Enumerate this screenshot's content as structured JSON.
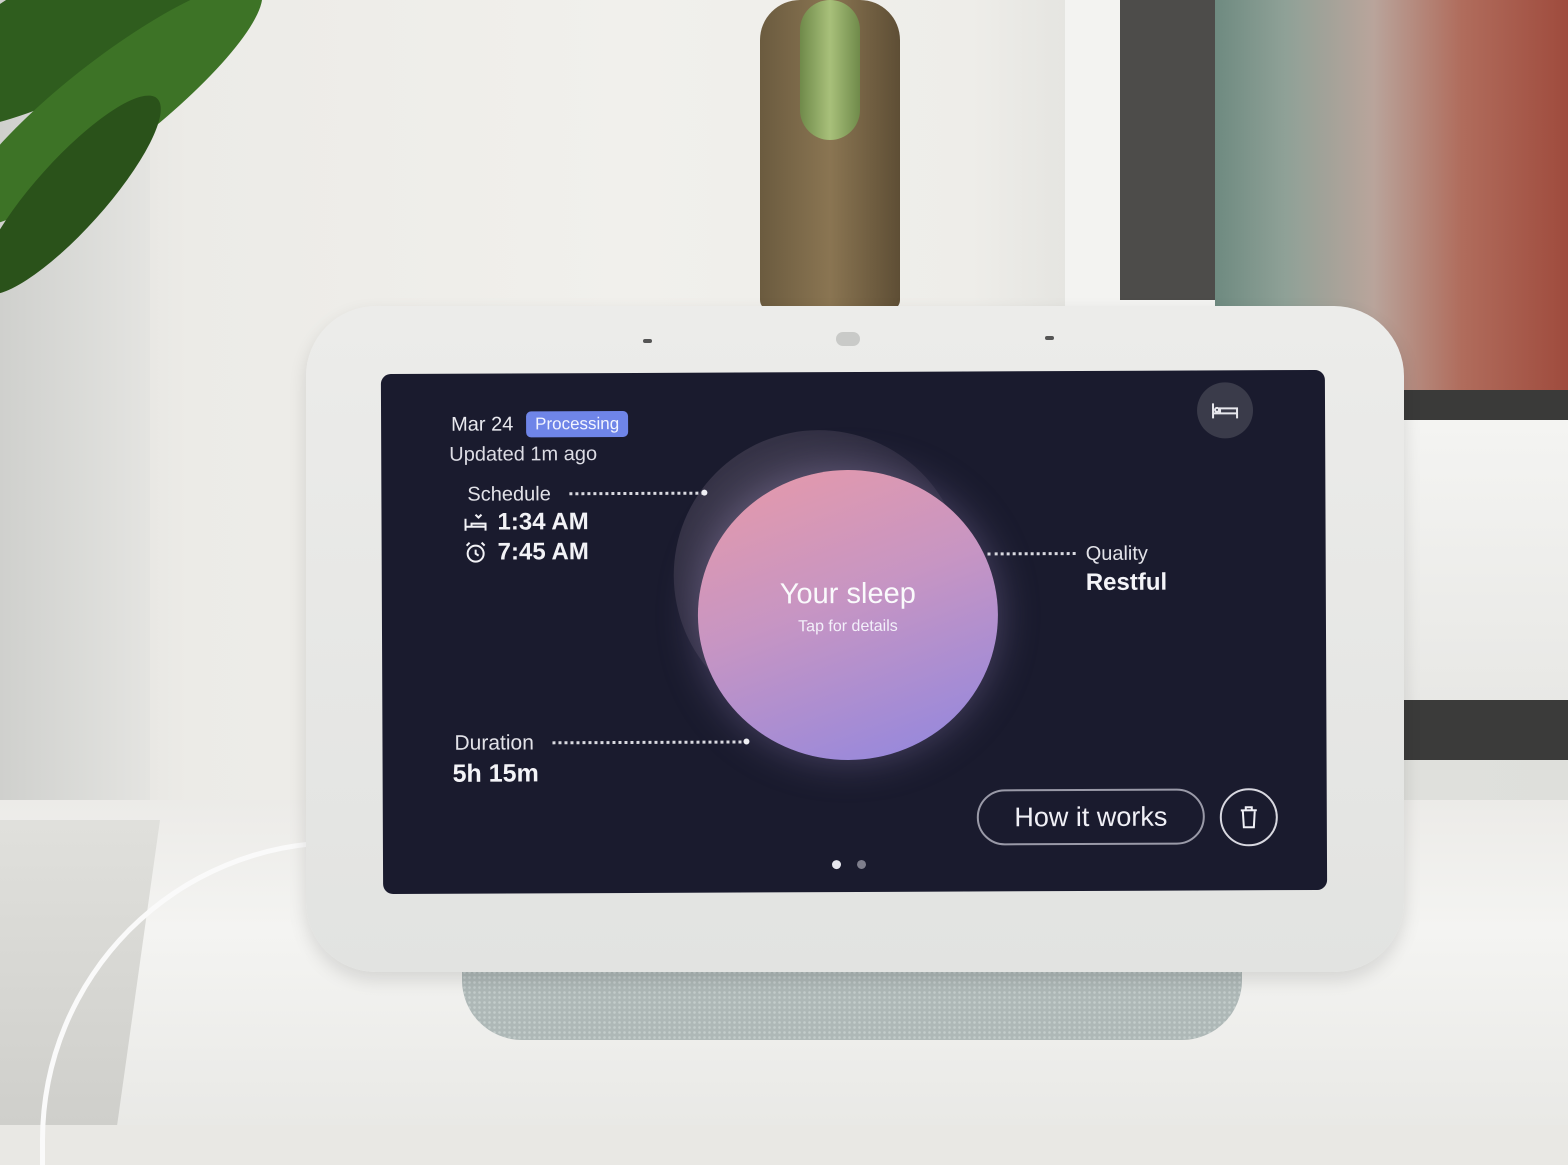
{
  "sleep_card": {
    "date": "Mar 24",
    "status_badge": "Processing",
    "updated": "Updated 1m ago",
    "schedule": {
      "label": "Schedule",
      "bedtime": "1:34 AM",
      "wake_time": "7:45 AM"
    },
    "center": {
      "title": "Your sleep",
      "subtitle": "Tap for details"
    },
    "quality": {
      "label": "Quality",
      "value": "Restful"
    },
    "duration": {
      "label": "Duration",
      "value": "5h 15m"
    },
    "actions": {
      "how_it_works": "How it works",
      "delete_icon": "trash-icon",
      "bed_icon": "bed-icon"
    },
    "pagination": {
      "pages": 2,
      "current": 1
    }
  },
  "colors": {
    "screen_bg": "#1a1b2e",
    "badge_bg": "#6f85e8",
    "orb_top": "#e89aa8",
    "orb_bottom": "#8f86e0"
  }
}
